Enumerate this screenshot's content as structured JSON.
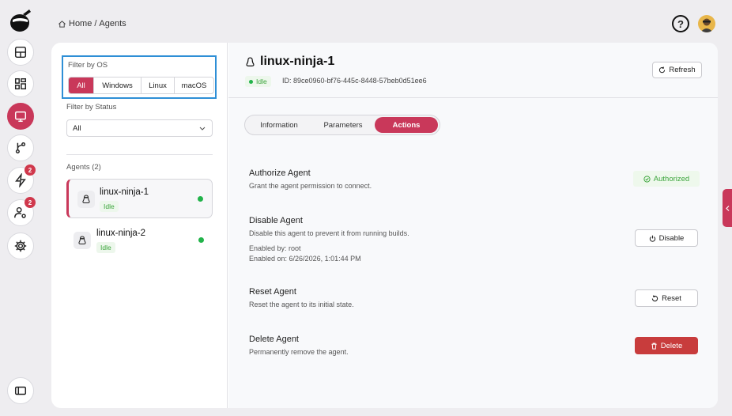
{
  "colors": {
    "accent": "#c9385a",
    "success": "#22b34a",
    "danger": "#c83c3c",
    "highlight": "#2e8fd6"
  },
  "breadcrumb": {
    "home": "Home",
    "separator": "/",
    "current": "Agents"
  },
  "header": {
    "help_icon": "question-circle-icon",
    "avatar_icon": "user-avatar-icon",
    "help_glyph": "?"
  },
  "rail": {
    "items": [
      {
        "name": "dashboard",
        "icon": "layout-icon"
      },
      {
        "name": "projects",
        "icon": "grid-icon"
      },
      {
        "name": "agents",
        "icon": "monitor-icon",
        "active": true
      },
      {
        "name": "pipelines",
        "icon": "branch-icon"
      },
      {
        "name": "builds",
        "icon": "bolt-icon",
        "badge": "2"
      },
      {
        "name": "users",
        "icon": "user-gear-icon",
        "badge": "2"
      },
      {
        "name": "settings",
        "icon": "gear-icon"
      },
      {
        "name": "collapse",
        "icon": "sidebar-toggle-icon"
      }
    ]
  },
  "filters": {
    "os_label": "Filter by OS",
    "os_options": [
      "All",
      "Windows",
      "Linux",
      "macOS"
    ],
    "os_selected": "All",
    "status_label": "Filter by Status",
    "status_value": "All"
  },
  "agents": {
    "label": "Agents (2)",
    "items": [
      {
        "name": "linux-ninja-1",
        "status": "Idle",
        "os_icon": "linux-icon"
      },
      {
        "name": "linux-ninja-2",
        "status": "Idle",
        "os_icon": "linux-icon"
      }
    ]
  },
  "detail": {
    "title": "linux-ninja-1",
    "status": "Idle",
    "id": "ID: 89ce0960-bf76-445c-8448-57beb0d51ee6",
    "refresh_label": "Refresh",
    "tabs": [
      "Information",
      "Parameters",
      "Actions"
    ],
    "active_tab": "Actions",
    "actions": {
      "authorize": {
        "title": "Authorize Agent",
        "desc": "Grant the agent permission to connect.",
        "status": "Authorized"
      },
      "disable": {
        "title": "Disable Agent",
        "desc": "Disable this agent to prevent it from running builds.",
        "enabled_by": "Enabled by: root",
        "enabled_on": "Enabled on: 6/26/2026, 1:01:44 PM",
        "button": "Disable"
      },
      "reset": {
        "title": "Reset Agent",
        "desc": "Reset the agent to its initial state.",
        "button": "Reset"
      },
      "delete": {
        "title": "Delete Agent",
        "desc": "Permanently remove the agent.",
        "button": "Delete"
      }
    }
  }
}
